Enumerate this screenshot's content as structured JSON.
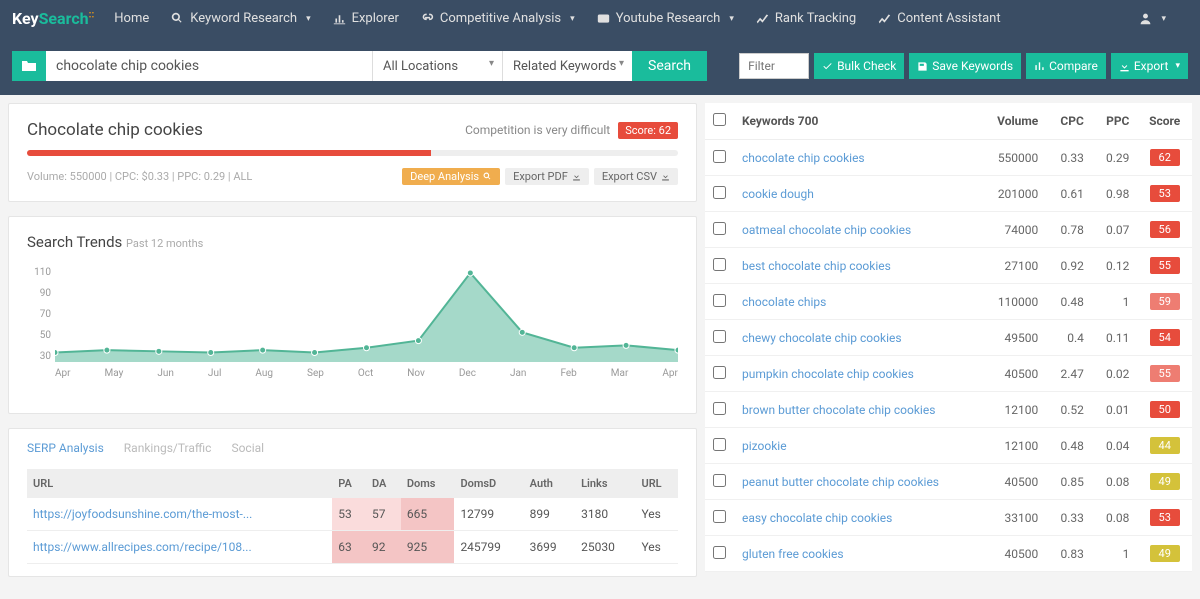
{
  "nav": {
    "brand": "KeySearch",
    "items": [
      "Home",
      "Keyword Research",
      "Explorer",
      "Competitive Analysis",
      "Youtube Research",
      "Rank Tracking",
      "Content Assistant"
    ]
  },
  "search": {
    "query": "chocolate chip cookies",
    "location": "All Locations",
    "type": "Related Keywords",
    "btn": "Search"
  },
  "tools": {
    "filter_ph": "Filter",
    "bulk": "Bulk Check",
    "save": "Save Keywords",
    "compare": "Compare",
    "export": "Export"
  },
  "kw": {
    "title": "Chocolate chip cookies",
    "comp": "Competition is very difficult",
    "score_label": "Score: 62",
    "meta": "Volume: 550000 | CPC: $0.33 | PPC: 0.29 | ALL",
    "deep": "Deep Analysis",
    "pdf": "Export PDF",
    "csv": "Export CSV",
    "progress_pct": 62
  },
  "trends": {
    "title": "Search Trends",
    "sub": "Past 12 months"
  },
  "chart_data": {
    "type": "area",
    "title": "Search Trends Past 12 months",
    "xlabel": "",
    "ylabel": "",
    "ylim": [
      30,
      110
    ],
    "categories": [
      "Apr",
      "May",
      "Jun",
      "Jul",
      "Aug",
      "Sep",
      "Oct",
      "Nov",
      "Dec",
      "Jan",
      "Feb",
      "Mar",
      "Apr"
    ],
    "values": [
      38,
      40,
      39,
      38,
      40,
      38,
      42,
      48,
      105,
      55,
      42,
      44,
      40
    ]
  },
  "serp": {
    "tabs": [
      "SERP Analysis",
      "Rankings/Traffic",
      "Social"
    ],
    "headers": [
      "URL",
      "PA",
      "DA",
      "Doms",
      "DomsD",
      "Auth",
      "Links",
      "URL"
    ],
    "rows": [
      {
        "url": "https://joyfoodsunshine.com/the-most-...",
        "pa": "53",
        "da": "57",
        "doms": "665",
        "domsd": "12799",
        "auth": "899",
        "links": "3180",
        "u2": "Yes"
      },
      {
        "url": "https://www.allrecipes.com/recipe/108...",
        "pa": "63",
        "da": "92",
        "doms": "925",
        "domsd": "245799",
        "auth": "3699",
        "links": "25030",
        "u2": "Yes"
      }
    ]
  },
  "kwtable": {
    "count_label": "Keywords 700",
    "headers": {
      "vol": "Volume",
      "cpc": "CPC",
      "ppc": "PPC",
      "score": "Score"
    },
    "rows": [
      {
        "kw": "chocolate chip cookies",
        "vol": "550000",
        "cpc": "0.33",
        "ppc": "0.29",
        "score": "62",
        "cls": "s-red"
      },
      {
        "kw": "cookie dough",
        "vol": "201000",
        "cpc": "0.61",
        "ppc": "0.98",
        "score": "53",
        "cls": "s-red"
      },
      {
        "kw": "oatmeal chocolate chip cookies",
        "vol": "74000",
        "cpc": "0.78",
        "ppc": "0.07",
        "score": "56",
        "cls": "s-red"
      },
      {
        "kw": "best chocolate chip cookies",
        "vol": "27100",
        "cpc": "0.92",
        "ppc": "0.12",
        "score": "55",
        "cls": "s-red"
      },
      {
        "kw": "chocolate chips",
        "vol": "110000",
        "cpc": "0.48",
        "ppc": "1",
        "score": "59",
        "cls": "s-lred"
      },
      {
        "kw": "chewy chocolate chip cookies",
        "vol": "49500",
        "cpc": "0.4",
        "ppc": "0.11",
        "score": "54",
        "cls": "s-red"
      },
      {
        "kw": "pumpkin chocolate chip cookies",
        "vol": "40500",
        "cpc": "2.47",
        "ppc": "0.02",
        "score": "55",
        "cls": "s-lred"
      },
      {
        "kw": "brown butter chocolate chip cookies",
        "vol": "12100",
        "cpc": "0.52",
        "ppc": "0.01",
        "score": "50",
        "cls": "s-red"
      },
      {
        "kw": "pizookie",
        "vol": "12100",
        "cpc": "0.48",
        "ppc": "0.04",
        "score": "44",
        "cls": "s-yel"
      },
      {
        "kw": "peanut butter chocolate chip cookies",
        "vol": "40500",
        "cpc": "0.85",
        "ppc": "0.08",
        "score": "49",
        "cls": "s-yel"
      },
      {
        "kw": "easy chocolate chip cookies",
        "vol": "33100",
        "cpc": "0.33",
        "ppc": "0.08",
        "score": "53",
        "cls": "s-red"
      },
      {
        "kw": "gluten free cookies",
        "vol": "40500",
        "cpc": "0.83",
        "ppc": "1",
        "score": "49",
        "cls": "s-yel"
      }
    ]
  }
}
